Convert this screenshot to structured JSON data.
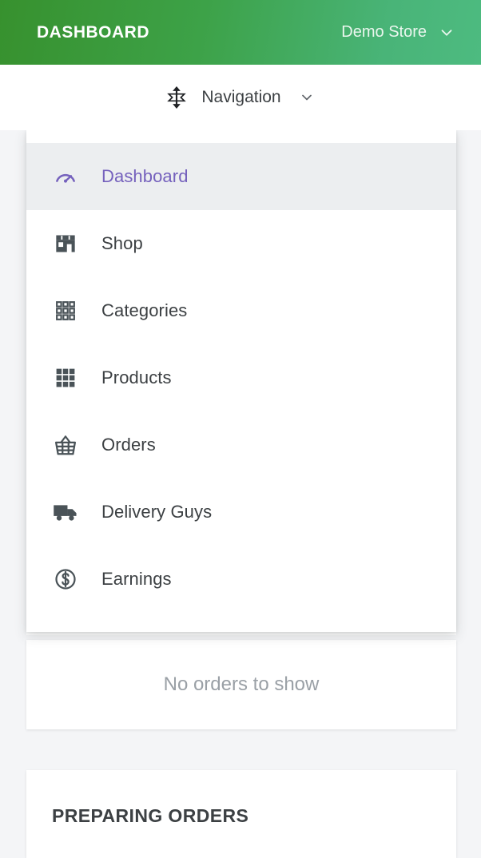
{
  "header": {
    "title": "DASHBOARD",
    "store_name": "Demo Store",
    "store_chevron_icon": "chevron-down-icon",
    "gradient_from": "#37912e",
    "gradient_to": "#4dbb80"
  },
  "navbar": {
    "move_icon": "vertical-resize-icon",
    "label": "Navigation",
    "chevron_icon": "chevron-down-icon"
  },
  "dropdown": {
    "open": true,
    "active_color": "#7561bd",
    "active_bg": "#eceef0",
    "items": [
      {
        "label": "Dashboard",
        "icon": "speedometer-icon",
        "active": true
      },
      {
        "label": "Shop",
        "icon": "storefront-icon",
        "active": false
      },
      {
        "label": "Categories",
        "icon": "grid-outline-icon",
        "active": false
      },
      {
        "label": "Products",
        "icon": "grid-filled-icon",
        "active": false
      },
      {
        "label": "Orders",
        "icon": "basket-icon",
        "active": false
      },
      {
        "label": "Delivery Guys",
        "icon": "truck-icon",
        "active": false
      },
      {
        "label": "Earnings",
        "icon": "dollar-circle-icon",
        "active": false
      }
    ]
  },
  "main": {
    "empty_orders_text": "No orders to show",
    "preparing_orders_title": "PREPARING ORDERS"
  }
}
